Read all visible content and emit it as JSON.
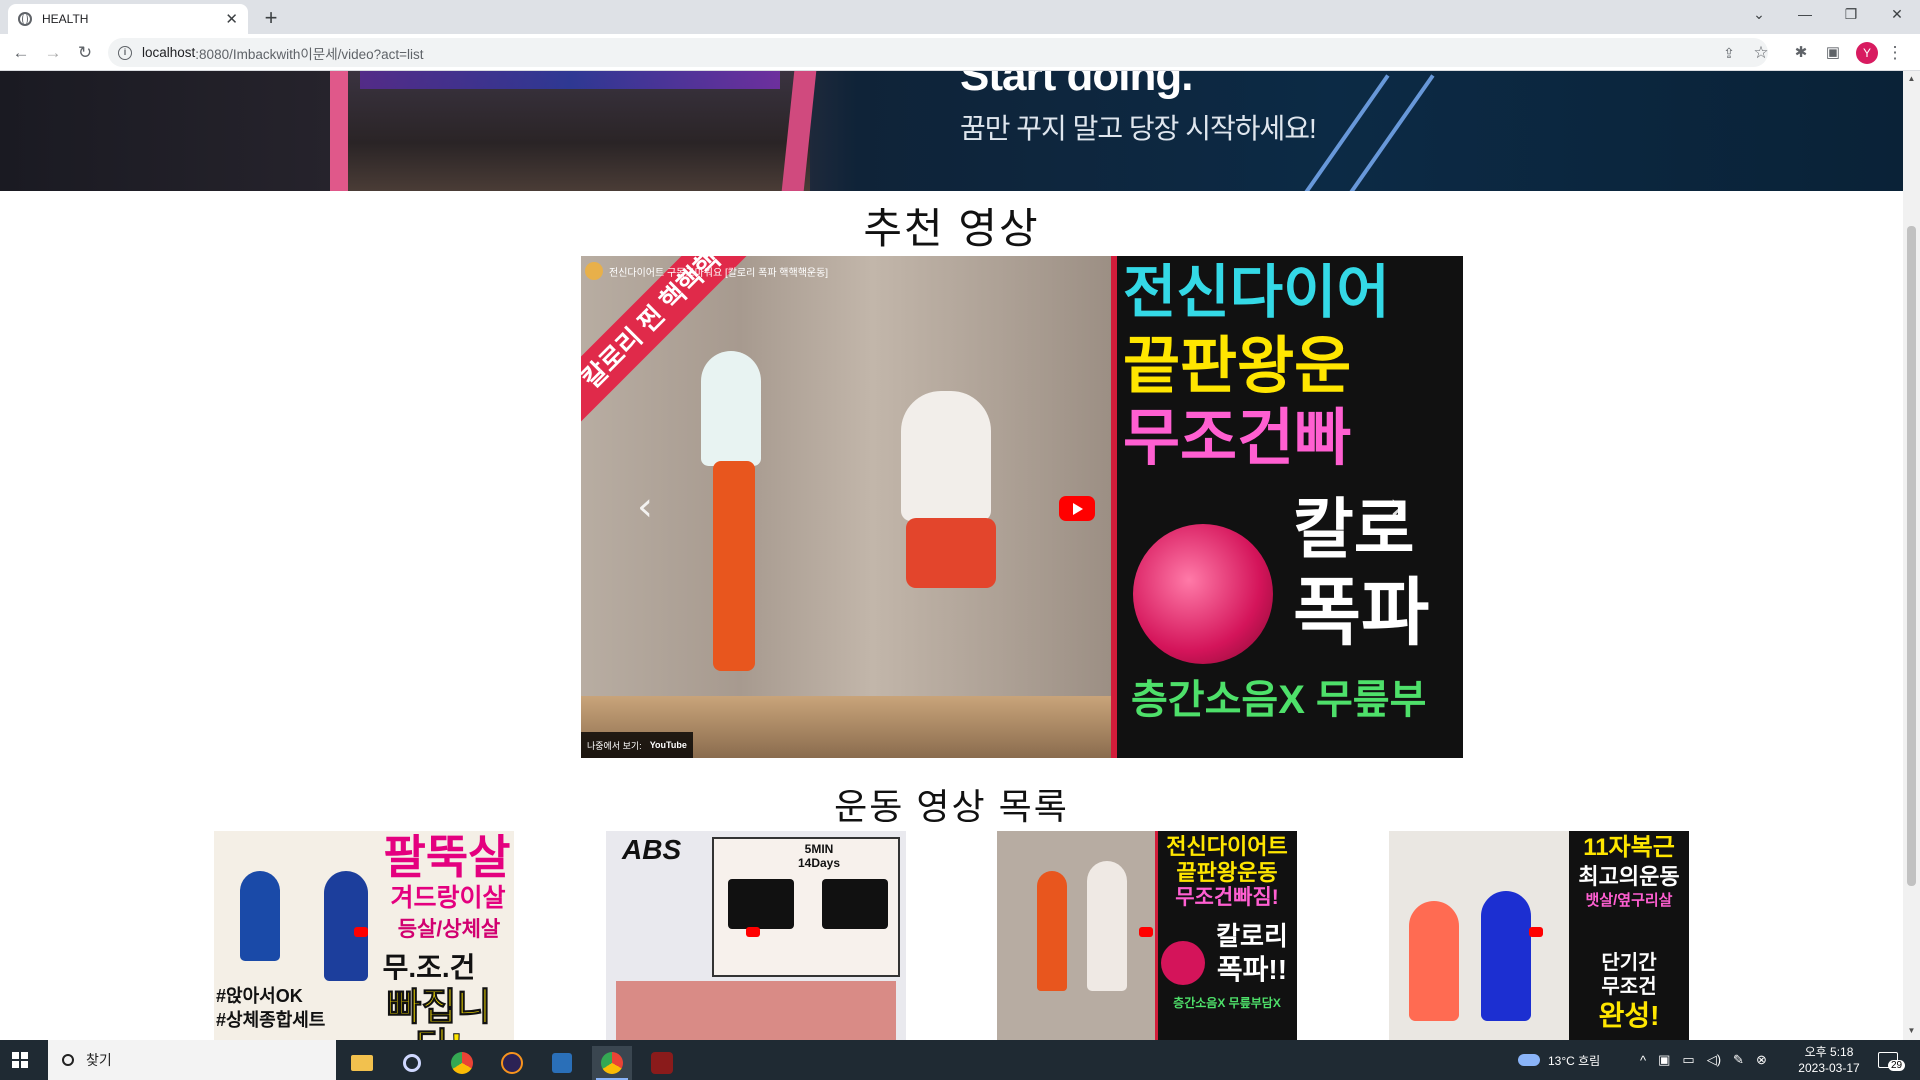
{
  "browser": {
    "tab_title": "HEALTH",
    "new_tab_glyph": "+",
    "close_glyph": "✕",
    "url_host": "localhost",
    "url_path": ":8080/Imbackwith이문세/video?act=list",
    "profile_initial": "Y",
    "window_controls": [
      "⌄",
      "—",
      "❐",
      "✕"
    ]
  },
  "banner": {
    "headline": "Start doing.",
    "subtitle": "꿈만 꾸지 말고 당장 시작하세요!"
  },
  "recommended": {
    "title": "추천 영상",
    "video": {
      "channel_text": "전신다이어트 구독고마워요 [칼로리 폭파 핵핵핵운동]",
      "ribbon_text": "칼로리 찐 핵핵핵",
      "overlay_lines": [
        "전신다이어",
        "끝판왕운",
        "무조건빠",
        "칼로",
        "폭파",
        "층간소음X 무릎부"
      ],
      "watch_on": "나중에서 보기:",
      "watch_brand": "YouTube",
      "prev_glyph": "‹",
      "next_glyph": "›"
    }
  },
  "list": {
    "title": "운동 영상 목록",
    "thumbnails": [
      {
        "lines": [
          "팔뚝살",
          "겨드랑이살",
          "등살/상체살",
          "무.조.건",
          "빠집니다!",
          "#앉아서OK",
          "#상체종합세트"
        ],
        "bg": "#f4efe6",
        "accent": "#e4007f"
      },
      {
        "lines": [
          "ABS",
          "5MIN",
          "14Days"
        ],
        "bg": "#e9e9ee",
        "accent": "#111111"
      },
      {
        "lines": [
          "전신다이어트",
          "끝판왕운동",
          "무조건빠짐!",
          "칼로리",
          "폭파!!",
          "층간소음X 무릎부담X"
        ],
        "bg": "#111111",
        "accent": "#ffe600"
      },
      {
        "lines": [
          "11자복근",
          "최고의운동",
          "뱃살/옆구리살",
          "단기간",
          "무조건",
          "완성!"
        ],
        "bg": "#111111",
        "accent": "#ffe600"
      }
    ]
  },
  "taskbar": {
    "search_text": "찾기",
    "weather": "13°C  흐림",
    "time": "오후 5:18",
    "date": "2023-03-17",
    "notification_count": "29"
  }
}
